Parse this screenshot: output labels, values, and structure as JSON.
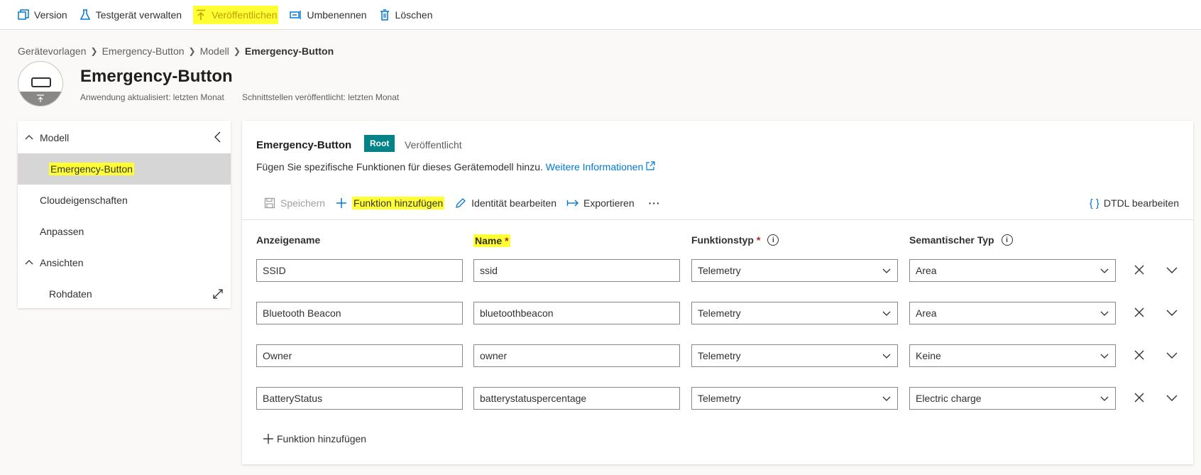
{
  "toolbar": {
    "version": "Version",
    "testgeraet": "Testgerät verwalten",
    "veroeffentlichen": "Veröffentlichen",
    "umbenennen": "Umbenennen",
    "loeschen": "Löschen"
  },
  "breadcrumb": [
    "Gerätevorlagen",
    "Emergency-Button",
    "Modell",
    "Emergency-Button"
  ],
  "header": {
    "title": "Emergency-Button",
    "updated": "Anwendung aktualisiert: letzten Monat",
    "published": "Schnittstellen veröffentlicht: letzten Monat"
  },
  "nav": {
    "modell": "Modell",
    "emergency": "Emergency-Button",
    "cloud": "Cloudeigenschaften",
    "anpassen": "Anpassen",
    "ansichten": "Ansichten",
    "rohdaten": "Rohdaten"
  },
  "main": {
    "title": "Emergency-Button",
    "badge": "Root",
    "status": "Veröffentlicht",
    "desc": "Fügen Sie spezifische Funktionen für dieses Gerätemodell hinzu.",
    "link": "Weitere Informationen"
  },
  "commands": {
    "speichern": "Speichern",
    "funktion": "Funktion hinzufügen",
    "identitaet": "Identität bearbeiten",
    "exportieren": "Exportieren",
    "more": "···",
    "dtdl": "DTDL bearbeiten"
  },
  "columns": {
    "anzeigename": "Anzeigename",
    "name": "Name",
    "funktionstyp": "Funktionstyp",
    "semantisch": "Semantischer Typ",
    "required": "*"
  },
  "rows": [
    {
      "display": "SSID",
      "name": "ssid",
      "type": "Telemetry",
      "semantic": "Area"
    },
    {
      "display": "Bluetooth Beacon",
      "name": "bluetoothbeacon",
      "type": "Telemetry",
      "semantic": "Area"
    },
    {
      "display": "Owner",
      "name": "owner",
      "type": "Telemetry",
      "semantic": "Keine"
    },
    {
      "display": "BatteryStatus",
      "name": "batterystatuspercentage",
      "type": "Telemetry",
      "semantic": "Electric charge"
    }
  ],
  "add_bottom": "Funktion hinzufügen",
  "info_glyph": "i",
  "colors": {
    "accent": "#0078d4",
    "root_badge": "#038387",
    "highlight": "#ffff33",
    "selected_nav": "#d6d6d6"
  }
}
